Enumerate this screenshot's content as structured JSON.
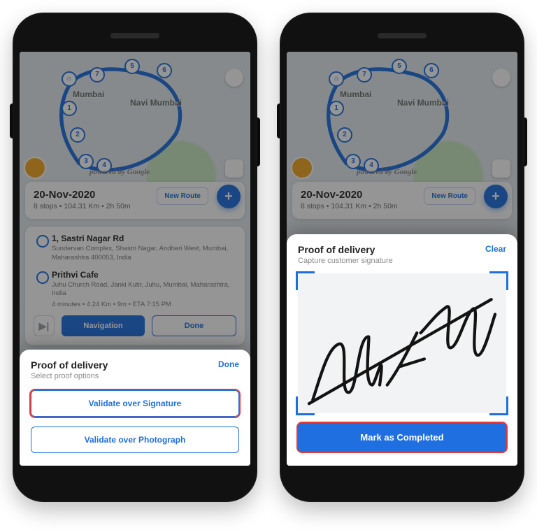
{
  "map": {
    "city1": "Mumbai",
    "city2": "Navi Mumbai",
    "attribution": "powered by Google",
    "stops": [
      "1",
      "2",
      "3",
      "4",
      "5",
      "6",
      "7"
    ]
  },
  "header": {
    "date": "20-Nov-2020",
    "summary": "8 stops • 104.31 Km • 2h 50m",
    "new_route": "New Route",
    "fab": "+"
  },
  "stops": [
    {
      "title": "1, Sastri Nagar Rd",
      "addr": "Sundervan Complex, Shastri Nagar, Andheri West, Mumbai, Maharashtra 400053, India"
    },
    {
      "title": "Prithvi Cafe",
      "addr": "Juhu Church Road, Janki Kutir, Juhu, Mumbai, Maharashtra, India",
      "meta": "4 minutes • 4.24 Km • 9m • ETA 7:15 PM"
    }
  ],
  "stop_actions": {
    "skip": "▶|",
    "navigation": "Navigation",
    "done": "Done"
  },
  "sheet_options": {
    "title": "Proof of delivery",
    "subtitle": "Select proof options",
    "done": "Done",
    "opt_signature": "Validate over Signature",
    "opt_photo": "Validate over Photograph"
  },
  "sheet_signature": {
    "title": "Proof of delivery",
    "subtitle": "Capture customer signature",
    "clear": "Clear",
    "submit": "Mark as Completed",
    "signature_text": "Rishabh"
  }
}
